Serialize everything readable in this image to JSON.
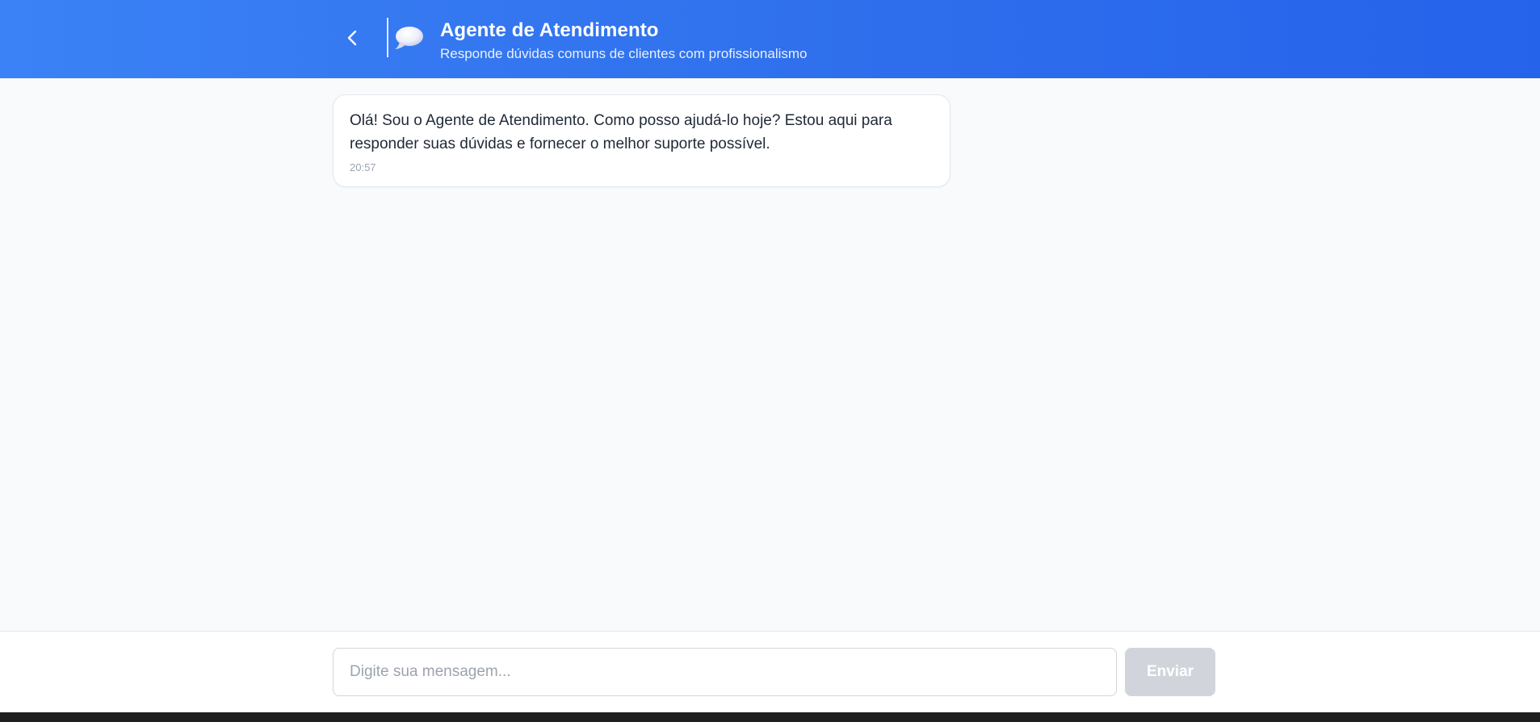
{
  "header": {
    "back_icon": "chevron-left-icon",
    "agent_icon": "speech-bubble-icon",
    "title": "Agente de Atendimento",
    "subtitle": "Responde dúvidas comuns de clientes com profissionalismo"
  },
  "messages": [
    {
      "sender": "agent",
      "text": "Olá! Sou o Agente de Atendimento. Como posso ajudá-lo hoje? Estou aqui para responder suas dúvidas e fornecer o melhor suporte possível.",
      "time": "20:57"
    }
  ],
  "composer": {
    "placeholder": "Digite sua mensagem...",
    "value": "",
    "send_label": "Enviar"
  },
  "colors": {
    "header_start": "#3b82f6",
    "header_end": "#2563eb",
    "send_disabled": "#d1d5db",
    "background": "#f8fafc"
  }
}
